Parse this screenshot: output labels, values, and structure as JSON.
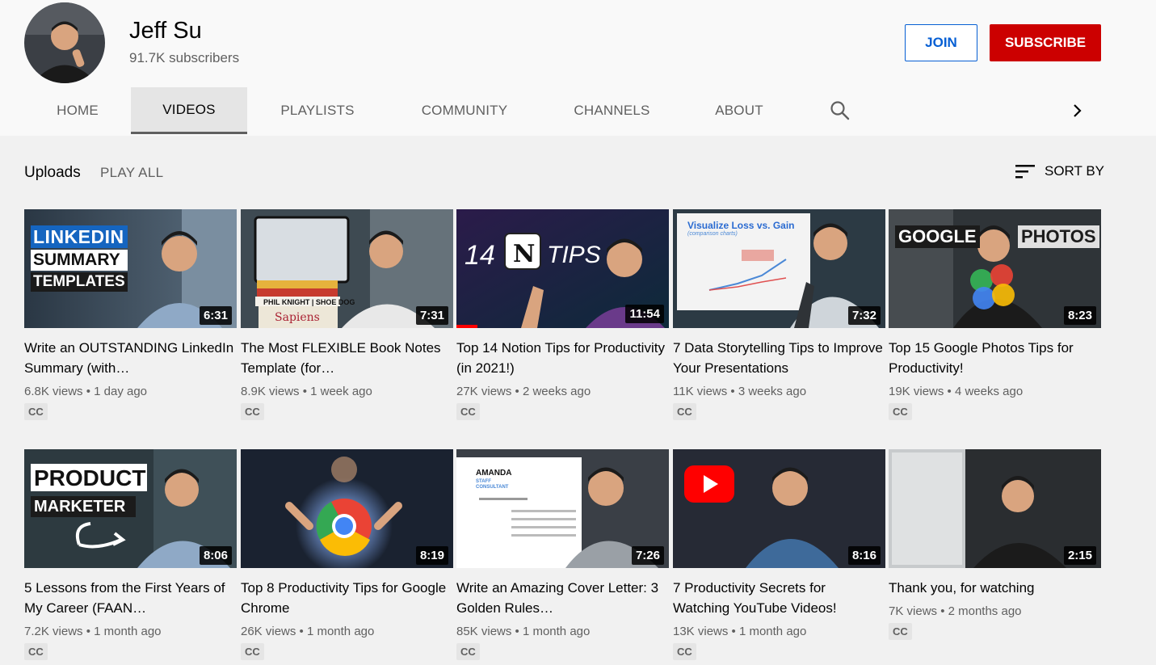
{
  "channel": {
    "name": "Jeff Su",
    "subscribers": "91.7K subscribers",
    "join_label": "JOIN",
    "subscribe_label": "SUBSCRIBE"
  },
  "tabs": [
    "HOME",
    "VIDEOS",
    "PLAYLISTS",
    "COMMUNITY",
    "CHANNELS",
    "ABOUT"
  ],
  "active_tab": "VIDEOS",
  "section": {
    "title": "Uploads",
    "play_all": "PLAY ALL",
    "sort_by": "SORT BY"
  },
  "colors": {
    "subscribe": "#cc0000",
    "join": "#065fd4",
    "progress": "#ff0000"
  },
  "videos": [
    {
      "title": "Write an OUTSTANDING LinkedIn Summary (with…",
      "meta": "6.8K views • 1 day ago",
      "duration": "6:31",
      "badge": "CC",
      "overlay": [
        "LINKEDIN",
        "SUMMARY",
        "TEMPLATES"
      ]
    },
    {
      "title": "The Most FLEXIBLE Book Notes Template (for…",
      "meta": "8.9K views • 1 week ago",
      "duration": "7:31",
      "badge": "CC",
      "overlay": [
        "PHIL KNIGHT | SHOE DOG",
        "Sapiens"
      ]
    },
    {
      "title": "Top 14 Notion Tips for Productivity (in 2021!)",
      "meta": "27K views • 2 weeks ago",
      "duration": "11:54",
      "badge": "CC",
      "overlay": [
        "14",
        "N",
        "TIPS"
      ],
      "progress": 0.1
    },
    {
      "title": "7 Data Storytelling Tips to Improve Your Presentations",
      "meta": "11K views • 3 weeks ago",
      "duration": "7:32",
      "badge": "CC",
      "overlay": [
        "Visualize Loss vs. Gain",
        "(comparison charts)"
      ]
    },
    {
      "title": "Top 15 Google Photos Tips for Productivity!",
      "meta": "19K views • 4 weeks ago",
      "duration": "8:23",
      "badge": "CC",
      "overlay": [
        "GOOGLE",
        "PHOTOS"
      ]
    },
    {
      "title": "5 Lessons from the First Years of My Career (FAAN…",
      "meta": "7.2K views • 1 month ago",
      "duration": "8:06",
      "badge": "CC",
      "overlay": [
        "PRODUCT",
        "MARKETER"
      ]
    },
    {
      "title": "Top 8 Productivity Tips for Google Chrome",
      "meta": "26K views • 1 month ago",
      "duration": "8:19",
      "badge": "CC",
      "overlay": []
    },
    {
      "title": "Write an Amazing Cover Letter: 3 Golden Rules…",
      "meta": "85K views • 1 month ago",
      "duration": "7:26",
      "badge": "CC",
      "overlay": [
        "AMANDA",
        "STAFF",
        "CONSULTANT"
      ]
    },
    {
      "title": "7 Productivity Secrets for Watching YouTube Videos!",
      "meta": "13K views • 1 month ago",
      "duration": "8:16",
      "badge": "CC",
      "overlay": []
    },
    {
      "title": "Thank you, for watching",
      "meta": "7K views • 2 months ago",
      "duration": "2:15",
      "badge": "CC",
      "overlay": []
    }
  ]
}
